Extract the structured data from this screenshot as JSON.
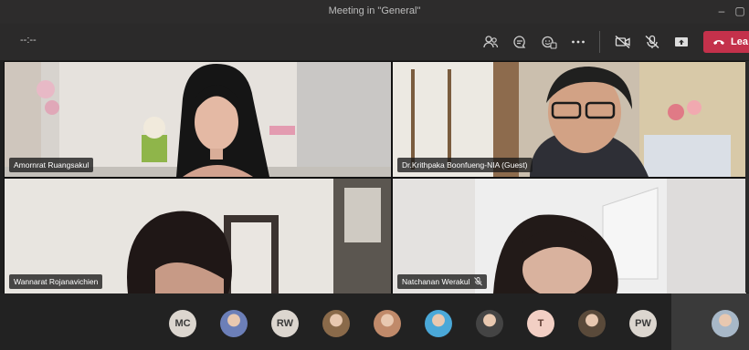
{
  "window": {
    "title": "Meeting in \"General\""
  },
  "toolbar": {
    "timer": "--:--",
    "leave_label": "Lea"
  },
  "participants": [
    {
      "name": "Amornrat Ruangsakul",
      "muted": false
    },
    {
      "name": "Dr.Krithpaka Boonfueng-NIA (Guest)",
      "muted": false
    },
    {
      "name": "Wannarat Rojanavichien",
      "muted": false
    },
    {
      "name": "Natchanan Werakul",
      "muted": true
    }
  ],
  "tray": {
    "avatars": [
      {
        "initials": "MC",
        "kind": "text"
      },
      {
        "initials": "",
        "kind": "photo",
        "color": "#6c7fb8"
      },
      {
        "initials": "RW",
        "kind": "text"
      },
      {
        "initials": "",
        "kind": "photo",
        "color": "#8a6a4a"
      },
      {
        "initials": "",
        "kind": "photo",
        "color": "#c08a6a"
      },
      {
        "initials": "",
        "kind": "photo",
        "color": "#4aa8d8"
      },
      {
        "initials": "",
        "kind": "photo",
        "color": "#444444"
      },
      {
        "initials": "T",
        "kind": "t"
      },
      {
        "initials": "",
        "kind": "photo",
        "color": "#5a4a3a"
      },
      {
        "initials": "PW",
        "kind": "text"
      },
      {
        "initials": "",
        "kind": "photo",
        "color": "#a8b8c8"
      }
    ]
  },
  "colors": {
    "leave": "#c4314b",
    "background": "#1f1f1f"
  }
}
